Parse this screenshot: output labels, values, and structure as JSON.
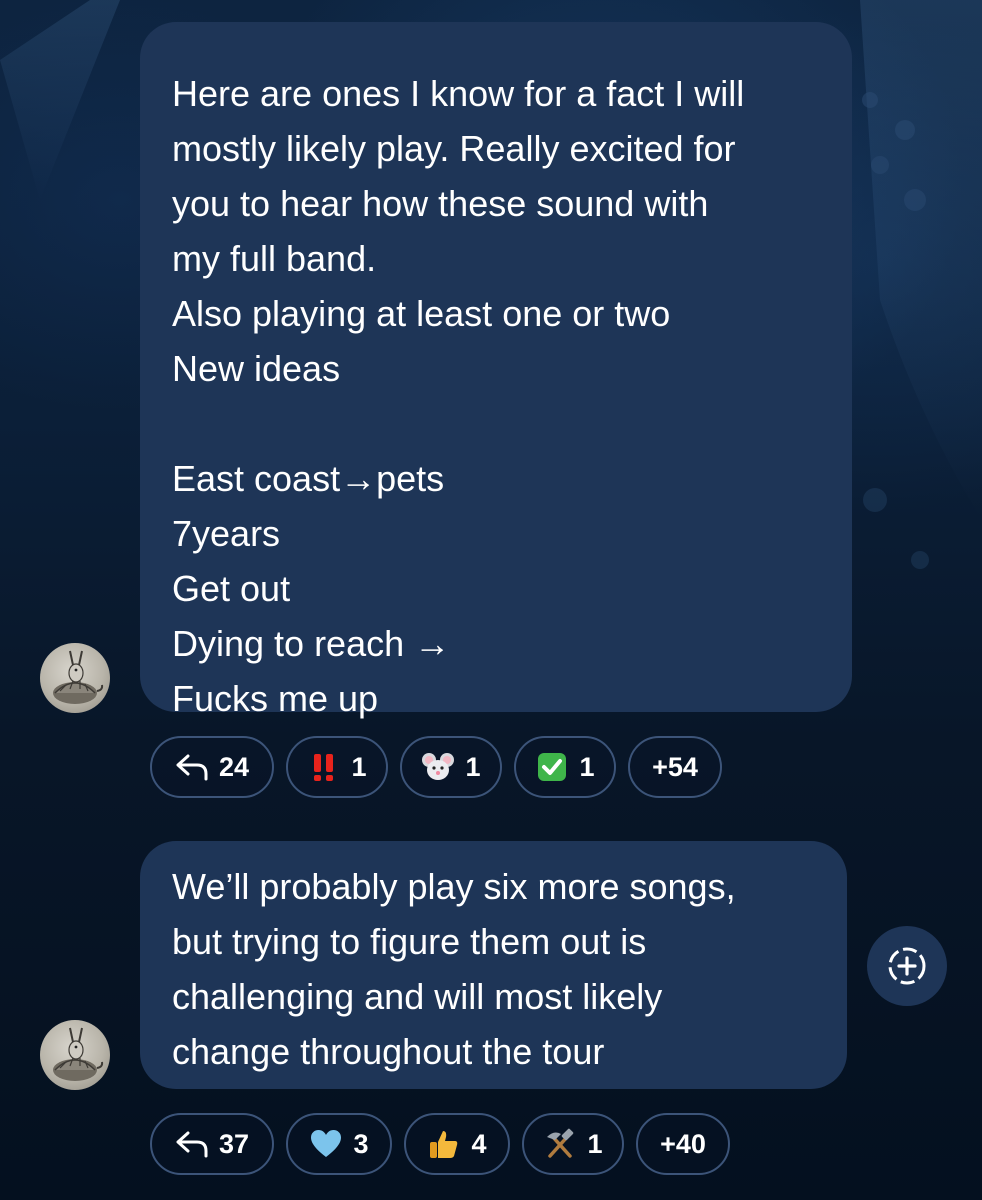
{
  "messages": [
    {
      "lines": [
        "Here are ones I know for a fact I will",
        "mostly likely play. Really excited for",
        "you to hear how these sound with",
        "my full band.",
        "Also playing at least one or two",
        "New ideas",
        "",
        "East coast→pets",
        "7years",
        "Get out",
        "Dying to reach →",
        "Fucks me up"
      ],
      "reactions": {
        "reply_count": "24",
        "r1": {
          "icon": "double-exclamation-icon",
          "count": "1"
        },
        "r2": {
          "icon": "mouse-face-icon",
          "count": "1"
        },
        "r3": {
          "icon": "check-mark-button-icon",
          "count": "1"
        },
        "more": "+54"
      }
    },
    {
      "lines": [
        "We’ll probably play six more songs,",
        "but trying to figure them out is",
        "challenging and will most likely",
        "change throughout the tour"
      ],
      "reactions": {
        "reply_count": "37",
        "r1": {
          "icon": "blue-heart-icon",
          "count": "3"
        },
        "r2": {
          "icon": "thumbs-up-icon",
          "count": "4"
        },
        "r3": {
          "icon": "hammer-and-pick-icon",
          "count": "1"
        },
        "more": "+40"
      }
    }
  ],
  "colors": {
    "bubble": "#1e3557",
    "chip_border": "#3c5479",
    "text": "#ffffff",
    "background": "#0b1f38"
  }
}
